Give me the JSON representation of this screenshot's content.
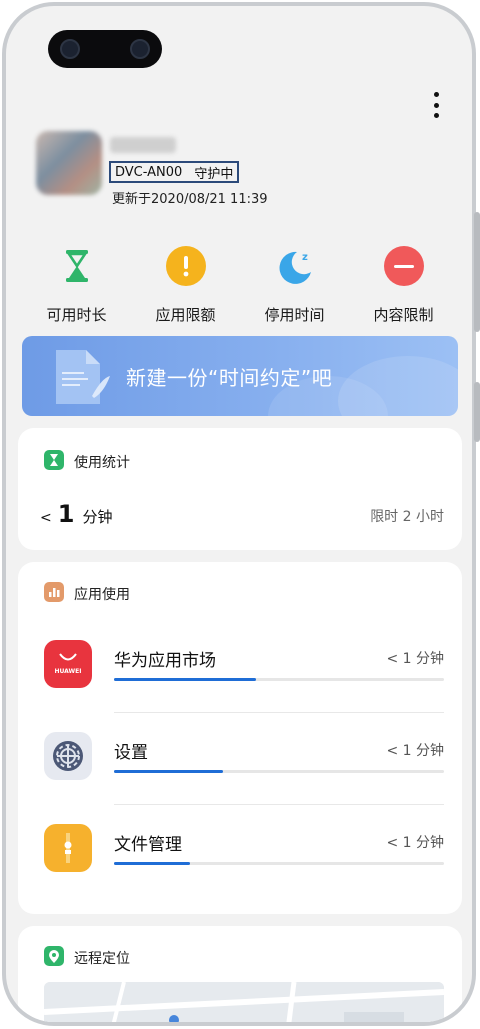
{
  "device": {
    "model": "DVC-AN00",
    "status": "守护中",
    "updated": "更新于2020/08/21 11:39"
  },
  "quick_actions": [
    {
      "label": "可用时长",
      "icon": "hourglass-icon",
      "color": "#2fb56a"
    },
    {
      "label": "应用限额",
      "icon": "exclamation-icon",
      "color": "#f5b31d"
    },
    {
      "label": "停用时间",
      "icon": "moon-sleep-icon",
      "color": "#3aa6e8"
    },
    {
      "label": "内容限制",
      "icon": "no-entry-icon",
      "color": "#f0595a"
    }
  ],
  "banner": {
    "text": "新建一份“时间约定”吧",
    "icon": "document-icon"
  },
  "usage_stats": {
    "title": "使用统计",
    "icon": "hourglass-icon",
    "less_than": "<",
    "value": "1",
    "unit": "分钟",
    "limit": "限时 2 小时"
  },
  "app_usage": {
    "title": "应用使用",
    "icon": "bar-chart-icon",
    "apps": [
      {
        "name": "华为应用市场",
        "time": "< 1 分钟",
        "progress": 0.43,
        "icon": "huawei-appgallery-icon",
        "icon_text": "HUAWEI"
      },
      {
        "name": "设置",
        "time": "< 1 分钟",
        "progress": 0.33,
        "icon": "settings-gear-icon"
      },
      {
        "name": "文件管理",
        "time": "< 1 分钟",
        "progress": 0.23,
        "icon": "file-manager-icon"
      }
    ]
  },
  "remote_location": {
    "title": "远程定位",
    "icon": "location-pin-icon"
  },
  "colors": {
    "accent": "#1f6dd6",
    "banner": "#7ea6ec"
  }
}
